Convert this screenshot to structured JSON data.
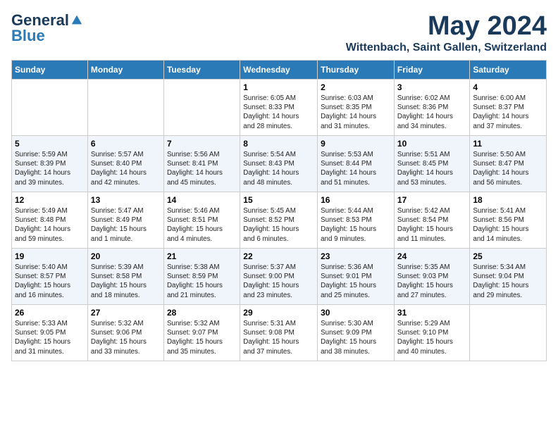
{
  "header": {
    "logo_general": "General",
    "logo_blue": "Blue",
    "month_title": "May 2024",
    "subtitle": "Wittenbach, Saint Gallen, Switzerland"
  },
  "days_of_week": [
    "Sunday",
    "Monday",
    "Tuesday",
    "Wednesday",
    "Thursday",
    "Friday",
    "Saturday"
  ],
  "weeks": [
    [
      {
        "day": "",
        "content": ""
      },
      {
        "day": "",
        "content": ""
      },
      {
        "day": "",
        "content": ""
      },
      {
        "day": "1",
        "content": "Sunrise: 6:05 AM\nSunset: 8:33 PM\nDaylight: 14 hours\nand 28 minutes."
      },
      {
        "day": "2",
        "content": "Sunrise: 6:03 AM\nSunset: 8:35 PM\nDaylight: 14 hours\nand 31 minutes."
      },
      {
        "day": "3",
        "content": "Sunrise: 6:02 AM\nSunset: 8:36 PM\nDaylight: 14 hours\nand 34 minutes."
      },
      {
        "day": "4",
        "content": "Sunrise: 6:00 AM\nSunset: 8:37 PM\nDaylight: 14 hours\nand 37 minutes."
      }
    ],
    [
      {
        "day": "5",
        "content": "Sunrise: 5:59 AM\nSunset: 8:39 PM\nDaylight: 14 hours\nand 39 minutes."
      },
      {
        "day": "6",
        "content": "Sunrise: 5:57 AM\nSunset: 8:40 PM\nDaylight: 14 hours\nand 42 minutes."
      },
      {
        "day": "7",
        "content": "Sunrise: 5:56 AM\nSunset: 8:41 PM\nDaylight: 14 hours\nand 45 minutes."
      },
      {
        "day": "8",
        "content": "Sunrise: 5:54 AM\nSunset: 8:43 PM\nDaylight: 14 hours\nand 48 minutes."
      },
      {
        "day": "9",
        "content": "Sunrise: 5:53 AM\nSunset: 8:44 PM\nDaylight: 14 hours\nand 51 minutes."
      },
      {
        "day": "10",
        "content": "Sunrise: 5:51 AM\nSunset: 8:45 PM\nDaylight: 14 hours\nand 53 minutes."
      },
      {
        "day": "11",
        "content": "Sunrise: 5:50 AM\nSunset: 8:47 PM\nDaylight: 14 hours\nand 56 minutes."
      }
    ],
    [
      {
        "day": "12",
        "content": "Sunrise: 5:49 AM\nSunset: 8:48 PM\nDaylight: 14 hours\nand 59 minutes."
      },
      {
        "day": "13",
        "content": "Sunrise: 5:47 AM\nSunset: 8:49 PM\nDaylight: 15 hours\nand 1 minute."
      },
      {
        "day": "14",
        "content": "Sunrise: 5:46 AM\nSunset: 8:51 PM\nDaylight: 15 hours\nand 4 minutes."
      },
      {
        "day": "15",
        "content": "Sunrise: 5:45 AM\nSunset: 8:52 PM\nDaylight: 15 hours\nand 6 minutes."
      },
      {
        "day": "16",
        "content": "Sunrise: 5:44 AM\nSunset: 8:53 PM\nDaylight: 15 hours\nand 9 minutes."
      },
      {
        "day": "17",
        "content": "Sunrise: 5:42 AM\nSunset: 8:54 PM\nDaylight: 15 hours\nand 11 minutes."
      },
      {
        "day": "18",
        "content": "Sunrise: 5:41 AM\nSunset: 8:56 PM\nDaylight: 15 hours\nand 14 minutes."
      }
    ],
    [
      {
        "day": "19",
        "content": "Sunrise: 5:40 AM\nSunset: 8:57 PM\nDaylight: 15 hours\nand 16 minutes."
      },
      {
        "day": "20",
        "content": "Sunrise: 5:39 AM\nSunset: 8:58 PM\nDaylight: 15 hours\nand 18 minutes."
      },
      {
        "day": "21",
        "content": "Sunrise: 5:38 AM\nSunset: 8:59 PM\nDaylight: 15 hours\nand 21 minutes."
      },
      {
        "day": "22",
        "content": "Sunrise: 5:37 AM\nSunset: 9:00 PM\nDaylight: 15 hours\nand 23 minutes."
      },
      {
        "day": "23",
        "content": "Sunrise: 5:36 AM\nSunset: 9:01 PM\nDaylight: 15 hours\nand 25 minutes."
      },
      {
        "day": "24",
        "content": "Sunrise: 5:35 AM\nSunset: 9:03 PM\nDaylight: 15 hours\nand 27 minutes."
      },
      {
        "day": "25",
        "content": "Sunrise: 5:34 AM\nSunset: 9:04 PM\nDaylight: 15 hours\nand 29 minutes."
      }
    ],
    [
      {
        "day": "26",
        "content": "Sunrise: 5:33 AM\nSunset: 9:05 PM\nDaylight: 15 hours\nand 31 minutes."
      },
      {
        "day": "27",
        "content": "Sunrise: 5:32 AM\nSunset: 9:06 PM\nDaylight: 15 hours\nand 33 minutes."
      },
      {
        "day": "28",
        "content": "Sunrise: 5:32 AM\nSunset: 9:07 PM\nDaylight: 15 hours\nand 35 minutes."
      },
      {
        "day": "29",
        "content": "Sunrise: 5:31 AM\nSunset: 9:08 PM\nDaylight: 15 hours\nand 37 minutes."
      },
      {
        "day": "30",
        "content": "Sunrise: 5:30 AM\nSunset: 9:09 PM\nDaylight: 15 hours\nand 38 minutes."
      },
      {
        "day": "31",
        "content": "Sunrise: 5:29 AM\nSunset: 9:10 PM\nDaylight: 15 hours\nand 40 minutes."
      },
      {
        "day": "",
        "content": ""
      }
    ]
  ]
}
